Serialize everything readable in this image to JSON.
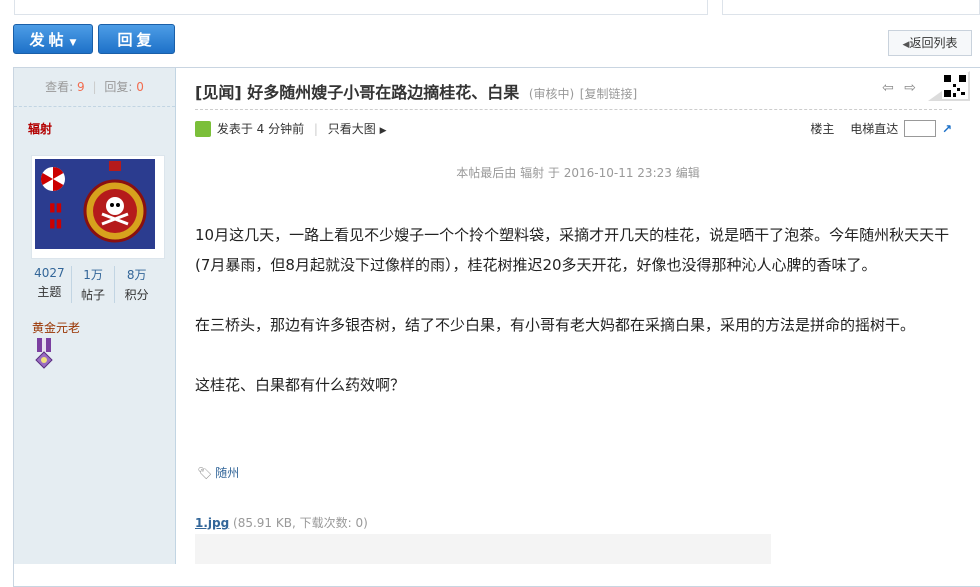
{
  "top_partial": [
    "...",
    "...",
    "...",
    "..."
  ],
  "toolbar": {
    "post_label": "发帖",
    "reply_label": "回复",
    "back_label": "返回列表"
  },
  "sidebar": {
    "views_label": "查看:",
    "views": "9",
    "replies_label": "回复:",
    "replies": "0",
    "author": "辐射",
    "stats": [
      {
        "value": "4027",
        "label": "主题"
      },
      {
        "value": "1万",
        "label": "帖子"
      },
      {
        "value": "8万",
        "label": "积分"
      }
    ],
    "rank": "黄金元老"
  },
  "post": {
    "category": "[见闻]",
    "title": "好多随州嫂子小哥在路边摘桂花、白果",
    "status": "(审核中)",
    "copy_link": "[复制链接]",
    "posted": "发表于 4 分钟前",
    "only_big_image": "只看大图",
    "floor_owner": "楼主",
    "elevator": "电梯直达",
    "edit_note": "本帖最后由 辐射 于 2016-10-11 23:23 编辑",
    "paragraphs": [
      "10月这几天，一路上看见不少嫂子一个个拎个塑料袋，采摘才开几天的桂花，说是晒干了泡茶。今年随州秋天天干(7月暴雨，但8月起就没下过像样的雨），桂花树推迟20多天开花，好像也没得那种沁人心脾的香味了。",
      "在三桥头，那边有许多银杏树，结了不少白果，有小哥有老大妈都在采摘白果，采用的方法是拼命的摇树干。",
      "这桂花、白果都有什么药效啊？"
    ],
    "tag": "随州",
    "attachment": {
      "name": "1.jpg",
      "info": "(85.91 KB, 下载次数: 0)"
    }
  }
}
